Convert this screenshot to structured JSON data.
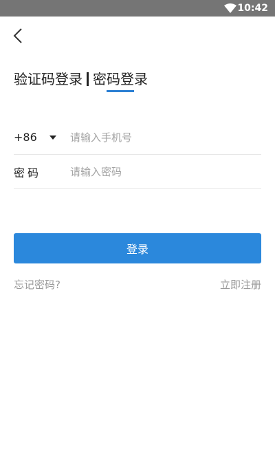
{
  "status_bar": {
    "time": "10:42"
  },
  "tabs": [
    {
      "label": "验证码登录"
    },
    {
      "label": "密码登录"
    }
  ],
  "phone": {
    "country_code": "+86",
    "placeholder": "请输入手机号"
  },
  "password": {
    "label": "密码",
    "placeholder": "请输入密码"
  },
  "login_button": {
    "label": "登录"
  },
  "links": {
    "forgot": "忘记密码?",
    "register": "立即注册"
  },
  "colors": {
    "accent": "#2b88dc",
    "status_bar": "#757575"
  }
}
